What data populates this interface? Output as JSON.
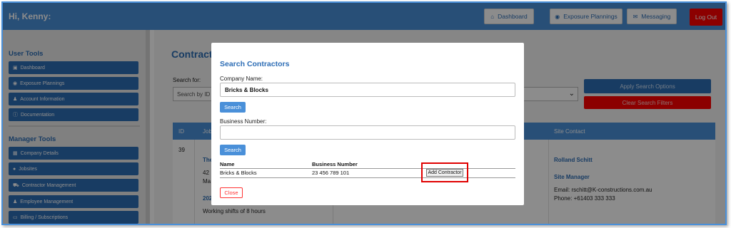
{
  "topbar": {
    "greeting": "Hi, Kenny:",
    "nav": [
      {
        "label": "Dashboard",
        "icon": "home-icon"
      },
      {
        "label": "Exposure Plannings",
        "icon": "gauge-icon"
      },
      {
        "label": "Messaging",
        "icon": "envelope-icon"
      }
    ],
    "logout": "Log Out"
  },
  "sidebar": {
    "user_heading": "User Tools",
    "user_items": [
      {
        "label": "Dashboard",
        "icon": "dashboard-icon"
      },
      {
        "label": "Exposure Plannings",
        "icon": "gauge-icon"
      },
      {
        "label": "Account Information",
        "icon": "user-icon"
      },
      {
        "label": "Documentation",
        "icon": "info-icon"
      }
    ],
    "manager_heading": "Manager Tools",
    "manager_items": [
      {
        "label": "Company Details",
        "icon": "building-icon"
      },
      {
        "label": "Jobsites",
        "icon": "map-pin-icon"
      },
      {
        "label": "Contractor Management",
        "icon": "truck-icon"
      },
      {
        "label": "Employee Management",
        "icon": "users-icon"
      },
      {
        "label": "Billing / Subscriptions",
        "icon": "credit-card-icon"
      }
    ]
  },
  "main": {
    "title": "Contract",
    "search_label": "Search for:",
    "search_placeholder": "Search by ID",
    "apply_label": "Apply Search Options",
    "clear_label": "Clear Search Filters",
    "table": {
      "headers": {
        "id": "ID",
        "job": "Job",
        "site_contact": "Site Contact"
      },
      "row": {
        "id": "39",
        "job_link": "The",
        "job_line1": "42",
        "job_line2": "Ma",
        "job_link2": "202",
        "shifts": "Working shifts of 8 hours",
        "contact_name": "Rolland Schitt",
        "contact_role": "Site Manager",
        "contact_email": "Email: rschitt@K-constructions.com.au",
        "contact_phone": "Phone: +61403 333 333"
      }
    }
  },
  "modal": {
    "title": "Search Contractors",
    "company_label": "Company Name:",
    "company_value": "Bricks & Blocks",
    "search1": "Search",
    "business_label": "Business Number:",
    "business_value": "",
    "search2": "Search",
    "results": {
      "headers": {
        "name": "Name",
        "business_number": "Business Number"
      },
      "rows": [
        {
          "name": "Bricks & Blocks",
          "business_number": "23 456 789 101",
          "action": "Add Contractor"
        }
      ]
    },
    "close": "Close"
  },
  "colors": {
    "primary": "#4a90d9",
    "primary_dark": "#2d6db5",
    "danger": "#ff0000",
    "highlight": "#e00000"
  }
}
